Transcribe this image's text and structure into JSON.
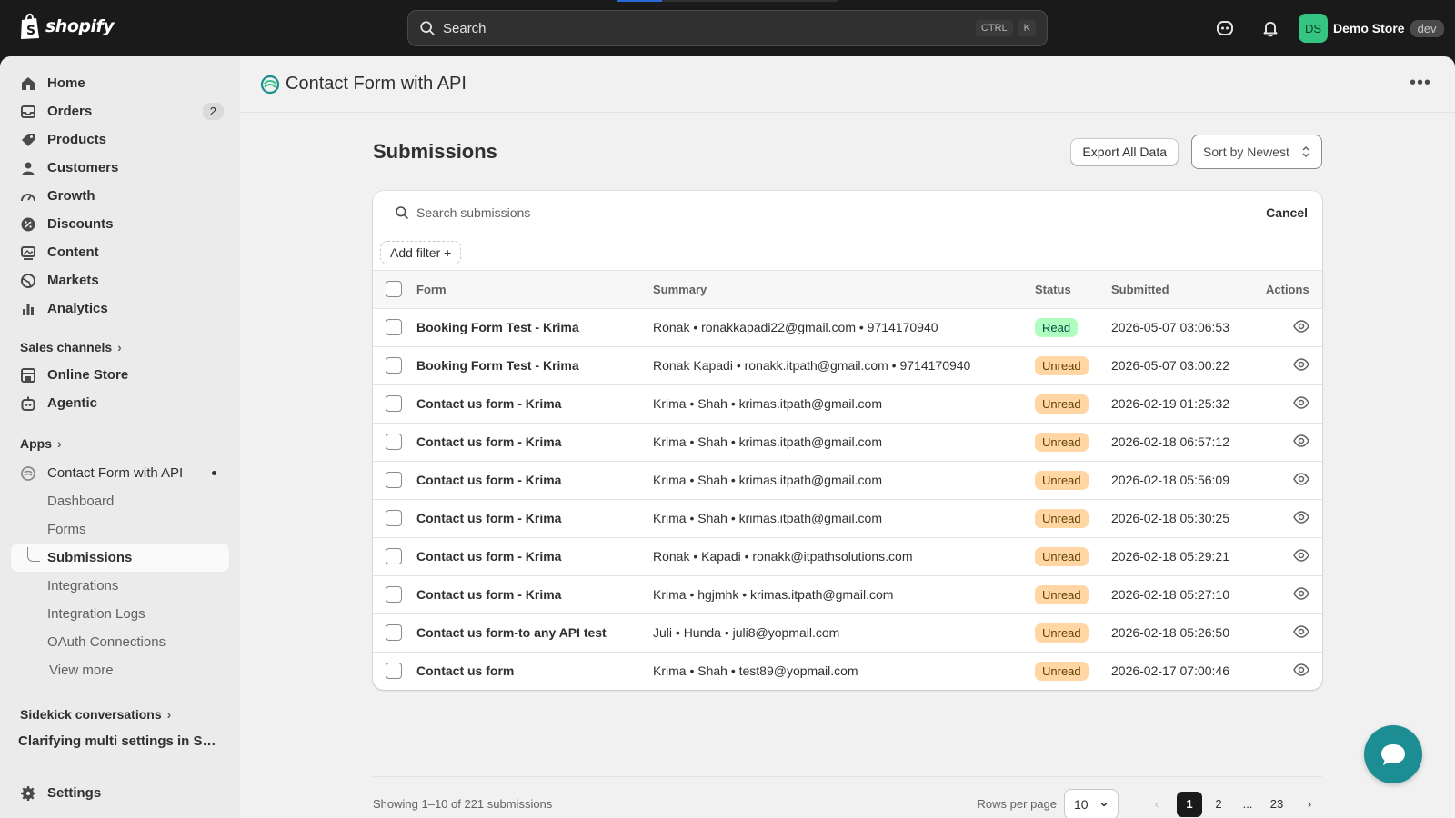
{
  "topbar": {
    "logo_text": "shopify",
    "search_placeholder": "Search",
    "kbd_ctrl": "CTRL",
    "kbd_k": "K",
    "store_initials": "DS",
    "store_name": "Demo Store",
    "store_badge": "dev"
  },
  "sidebar": {
    "nav": [
      {
        "label": "Home",
        "icon": "home-icon"
      },
      {
        "label": "Orders",
        "icon": "inbox-icon",
        "count": "2"
      },
      {
        "label": "Products",
        "icon": "tag-icon"
      },
      {
        "label": "Customers",
        "icon": "person-icon"
      },
      {
        "label": "Growth",
        "icon": "gauge-icon"
      },
      {
        "label": "Discounts",
        "icon": "discount-icon"
      },
      {
        "label": "Content",
        "icon": "image-icon"
      },
      {
        "label": "Markets",
        "icon": "globe-icon"
      },
      {
        "label": "Analytics",
        "icon": "bar-chart-icon"
      }
    ],
    "sales_channels_label": "Sales channels",
    "channels": [
      {
        "label": "Online Store",
        "icon": "store-icon"
      },
      {
        "label": "Agentic",
        "icon": "robot-icon"
      }
    ],
    "apps_label": "Apps",
    "app_name": "Contact Form with API",
    "app_sub_items": [
      "Dashboard",
      "Forms",
      "Submissions",
      "Integrations",
      "Integration Logs",
      "OAuth Connections"
    ],
    "view_more": "View more",
    "sidekick_label": "Sidekick conversations",
    "conversation": "Clarifying multi settings in Sho...",
    "settings": "Settings"
  },
  "page": {
    "app_title": "Contact Form with API",
    "title": "Submissions",
    "export_label": "Export All Data",
    "sort_label": "Sort by Newest",
    "search_placeholder": "Search submissions",
    "cancel_label": "Cancel",
    "add_filter_label": "Add filter +"
  },
  "table": {
    "columns": [
      "Form",
      "Summary",
      "Status",
      "Submitted",
      "Actions"
    ],
    "rows": [
      {
        "form": "Booking Form Test - Krima",
        "summary": "Ronak • ronakkapadi22@gmail.com • 9714170940",
        "status": "Read",
        "submitted": "2026-05-07 03:06:53"
      },
      {
        "form": "Booking Form Test - Krima",
        "summary": "Ronak Kapadi • ronakk.itpath@gmail.com • 9714170940",
        "status": "Unread",
        "submitted": "2026-05-07 03:00:22"
      },
      {
        "form": "Contact us form - Krima",
        "summary": "Krima • Shah • krimas.itpath@gmail.com",
        "status": "Unread",
        "submitted": "2026-02-19 01:25:32"
      },
      {
        "form": "Contact us form - Krima",
        "summary": "Krima • Shah • krimas.itpath@gmail.com",
        "status": "Unread",
        "submitted": "2026-02-18 06:57:12"
      },
      {
        "form": "Contact us form - Krima",
        "summary": "Krima • Shah • krimas.itpath@gmail.com",
        "status": "Unread",
        "submitted": "2026-02-18 05:56:09"
      },
      {
        "form": "Contact us form - Krima",
        "summary": "Krima • Shah • krimas.itpath@gmail.com",
        "status": "Unread",
        "submitted": "2026-02-18 05:30:25"
      },
      {
        "form": "Contact us form - Krima",
        "summary": "Ronak • Kapadi • ronakk@itpathsolutions.com",
        "status": "Unread",
        "submitted": "2026-02-18 05:29:21"
      },
      {
        "form": "Contact us form - Krima",
        "summary": "Krima • hgjmhk • krimas.itpath@gmail.com",
        "status": "Unread",
        "submitted": "2026-02-18 05:27:10"
      },
      {
        "form": "Contact us form-to any API test",
        "summary": "Juli • Hunda • juli8@yopmail.com",
        "status": "Unread",
        "submitted": "2026-02-18 05:26:50"
      },
      {
        "form": "Contact us form",
        "summary": "Krima • Shah • test89@yopmail.com",
        "status": "Unread",
        "submitted": "2026-02-17 07:00:46"
      }
    ]
  },
  "footer": {
    "showing": "Showing 1–10 of 221 submissions",
    "rows_per_page_label": "Rows per page",
    "rows_per_page": "10",
    "pages": [
      "1",
      "2",
      "...",
      "23"
    ]
  },
  "colors": {
    "read_badge": "#affebf",
    "unread_badge": "#ffd6a4",
    "chat": "#1c8d92",
    "avatar": "#36c482"
  }
}
